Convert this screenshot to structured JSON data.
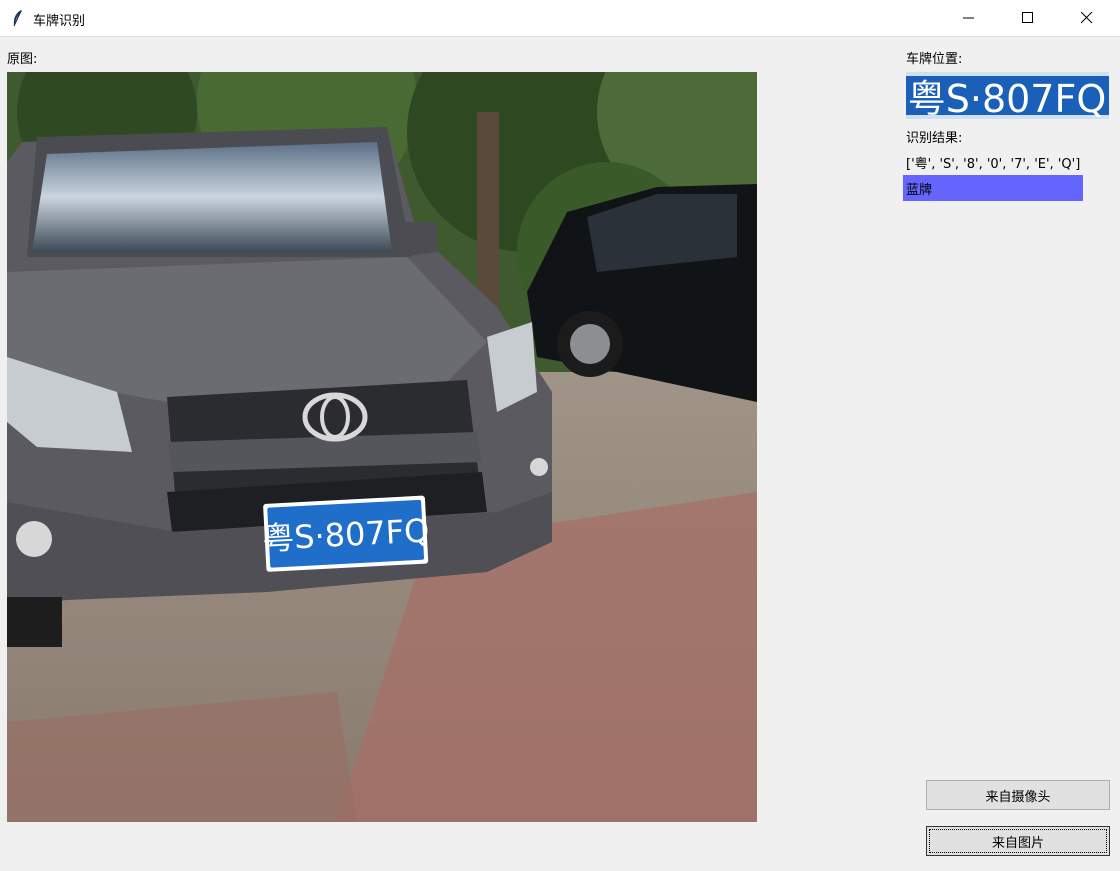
{
  "window": {
    "title": "车牌识别",
    "icon": "feather-icon",
    "controls": [
      "minimize-icon",
      "maximize-icon",
      "close-icon"
    ]
  },
  "left": {
    "original_label": "原图:"
  },
  "right": {
    "plate_position_label": "车牌位置:",
    "plate_text": "粤S·807FQ",
    "result_label": "识别结果:",
    "result_value": "['粤', 'S', '8', '0', '7', 'E', 'Q']",
    "plate_color": "蓝牌",
    "plate_color_bg": "#6666ff"
  },
  "buttons": {
    "camera": "来自摄像头",
    "image": "来自图片"
  },
  "photo": {
    "plate_text": "粤S·807FQ",
    "plate_color": "#1f6ec9"
  }
}
